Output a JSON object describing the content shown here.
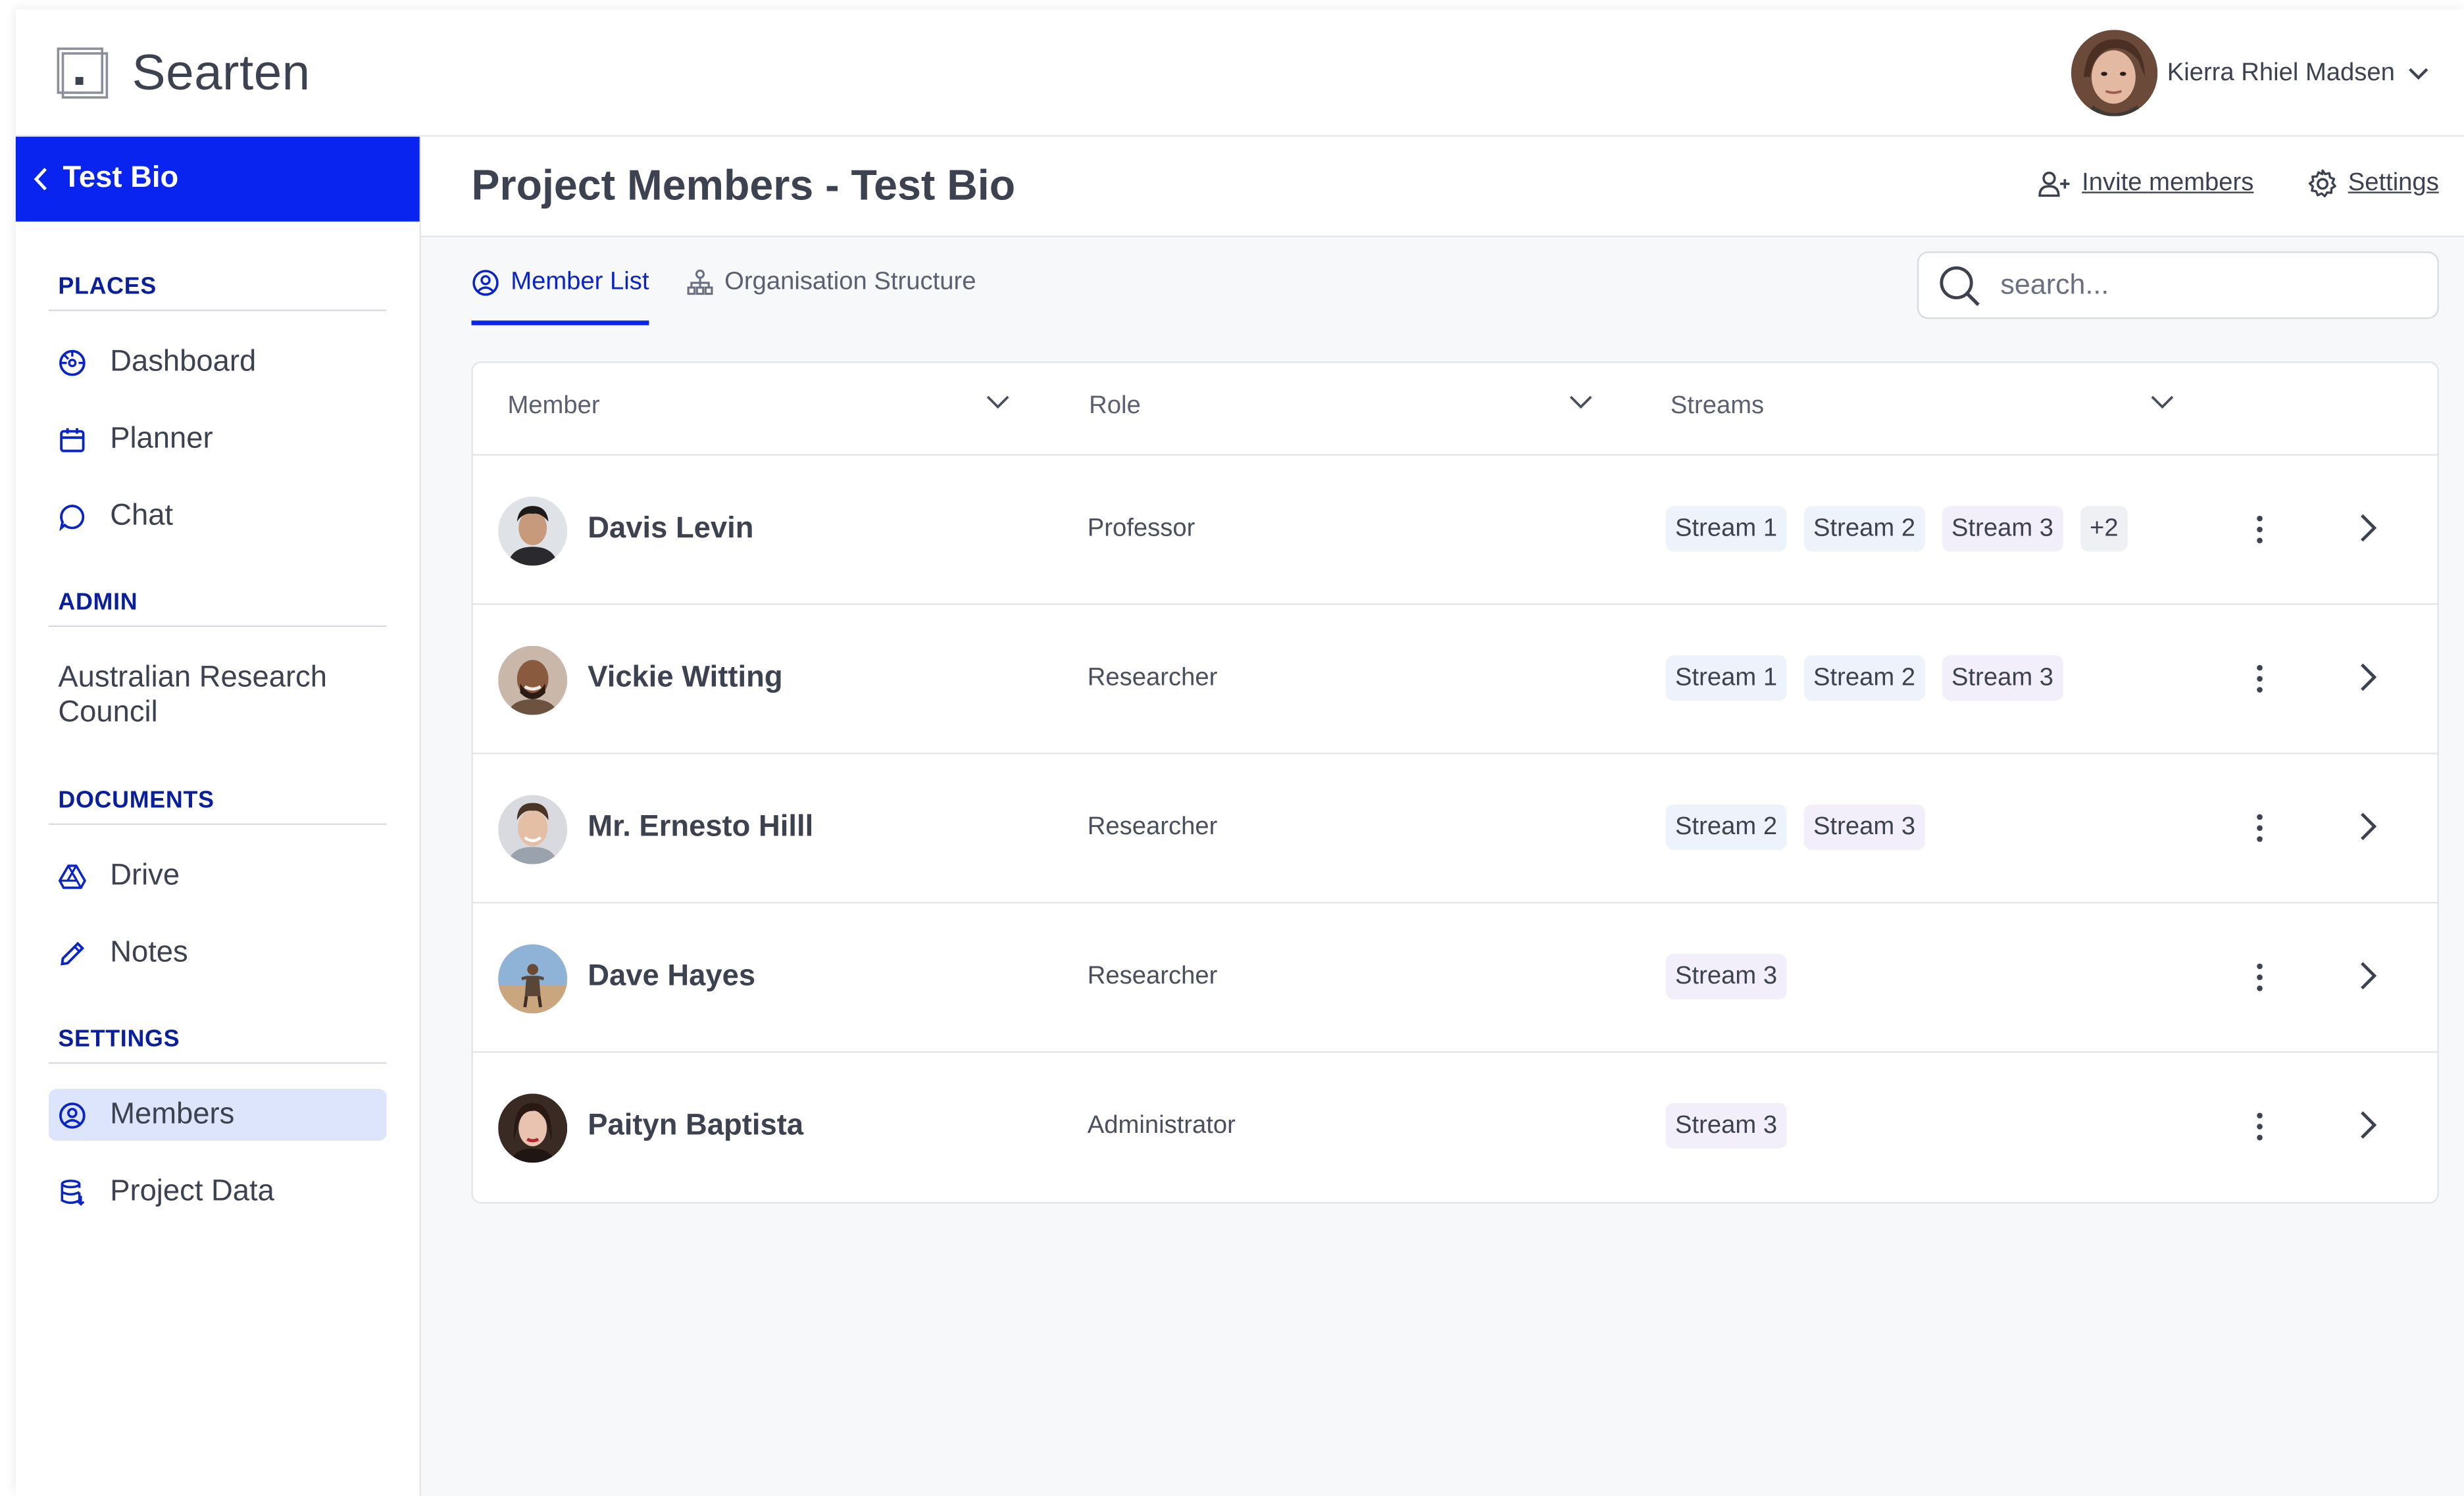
{
  "app": {
    "name": "Searten"
  },
  "user": {
    "name": "Kierra Rhiel Madsen"
  },
  "sidebar": {
    "back_label": "Test Bio",
    "sections": {
      "places": {
        "title": "PLACES",
        "items": [
          {
            "label": "Dashboard",
            "icon": "dashboard-icon"
          },
          {
            "label": "Planner",
            "icon": "calendar-icon"
          },
          {
            "label": "Chat",
            "icon": "chat-icon"
          }
        ]
      },
      "admin": {
        "title": "ADMIN",
        "items": [
          {
            "label": "Australian Research Council"
          }
        ]
      },
      "documents": {
        "title": "DOCUMENTS",
        "items": [
          {
            "label": "Drive",
            "icon": "drive-icon"
          },
          {
            "label": "Notes",
            "icon": "pencil-icon"
          }
        ]
      },
      "settings": {
        "title": "SETTINGS",
        "items": [
          {
            "label": "Members",
            "icon": "members-icon",
            "active": true
          },
          {
            "label": "Project Data",
            "icon": "database-icon"
          }
        ]
      }
    }
  },
  "header": {
    "title": "Project Members - Test Bio",
    "invite_label": "Invite members",
    "settings_label": "Settings"
  },
  "tabs": [
    {
      "label": "Member List",
      "active": true
    },
    {
      "label": "Organisation Structure",
      "active": false
    }
  ],
  "search": {
    "placeholder": "search..."
  },
  "table": {
    "columns": [
      "Member",
      "Role",
      "Streams"
    ],
    "rows": [
      {
        "name": "Davis Levin",
        "role": "Professor",
        "streams": [
          "Stream 1",
          "Stream 2",
          "Stream 3"
        ],
        "more": "+2"
      },
      {
        "name": "Vickie Witting",
        "role": "Researcher",
        "streams": [
          "Stream 1",
          "Stream 2",
          "Stream 3"
        ]
      },
      {
        "name": "Mr. Ernesto Hilll",
        "role": "Researcher",
        "streams": [
          "Stream 2",
          "Stream 3"
        ]
      },
      {
        "name": "Dave Hayes",
        "role": "Researcher",
        "streams": [
          "Stream 3"
        ]
      },
      {
        "name": "Paityn Baptista",
        "role": "Administrator",
        "streams": [
          "Stream 3"
        ]
      }
    ]
  },
  "colors": {
    "accent": "#0a24f0",
    "section_heading": "#0a1f9c",
    "active_nav": "#dce5fb"
  }
}
